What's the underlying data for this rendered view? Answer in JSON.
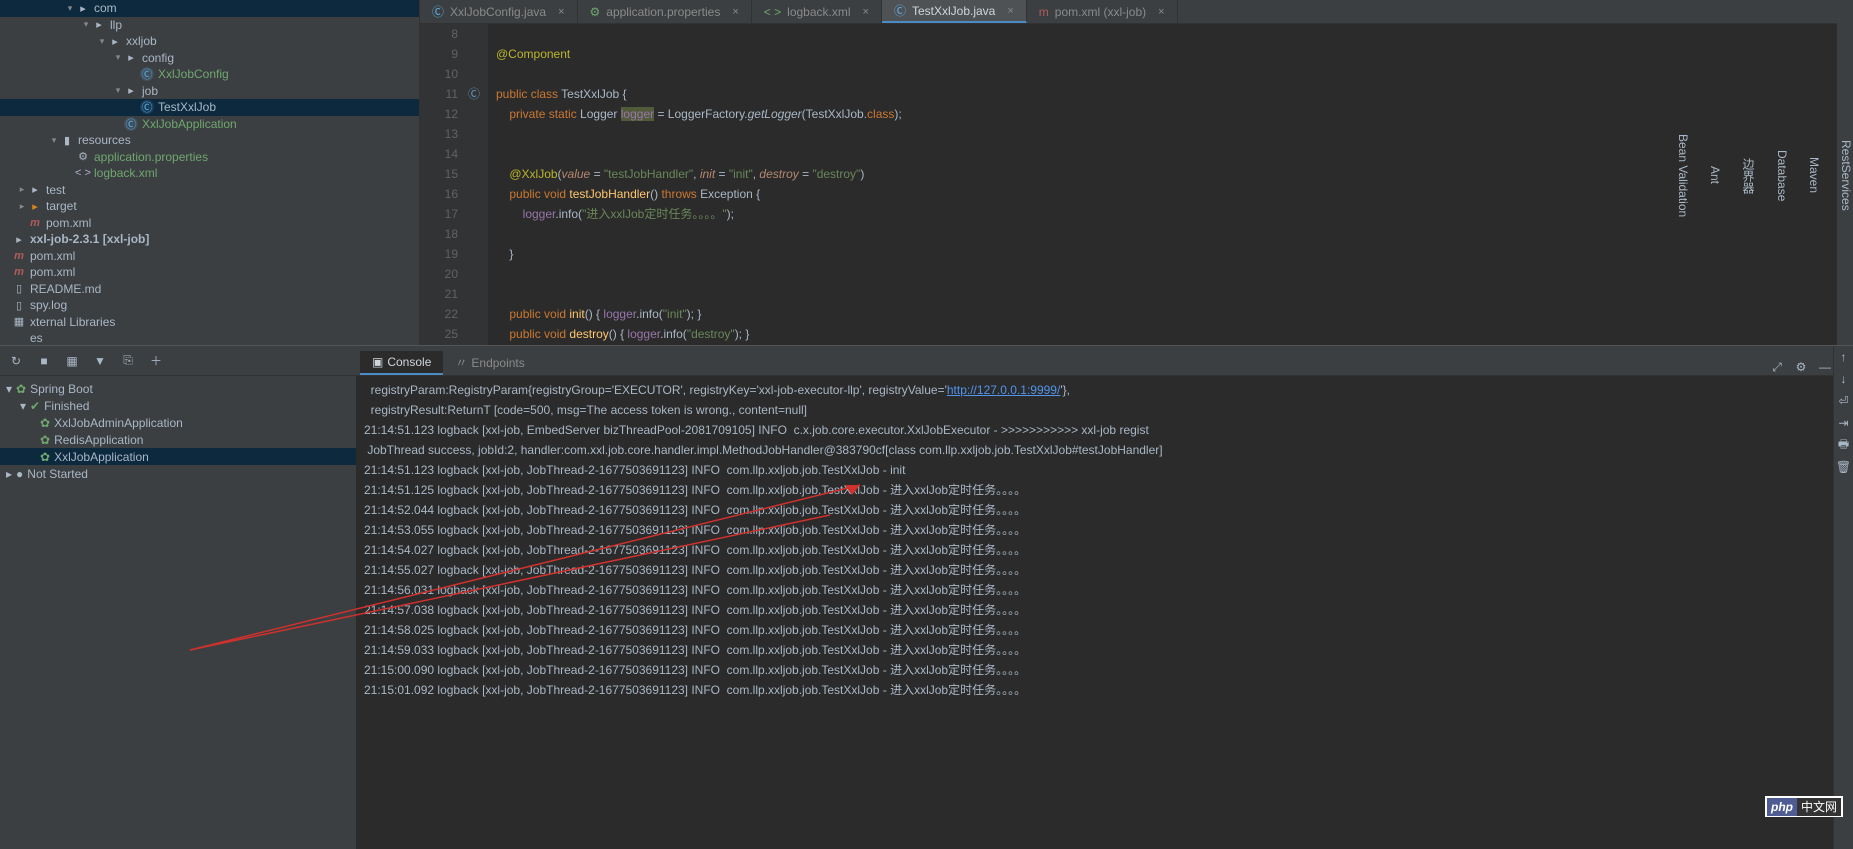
{
  "tree": [
    {
      "indent": 64,
      "arrow": "▾",
      "icon": "pkg",
      "label": "com"
    },
    {
      "indent": 80,
      "arrow": "▾",
      "icon": "pkg",
      "label": "llp"
    },
    {
      "indent": 96,
      "arrow": "▾",
      "icon": "pkg",
      "label": "xxljob"
    },
    {
      "indent": 112,
      "arrow": "▾",
      "icon": "pkg",
      "label": "config"
    },
    {
      "indent": 128,
      "arrow": "",
      "icon": "class",
      "label": "XxlJobConfig",
      "green": true
    },
    {
      "indent": 112,
      "arrow": "▾",
      "icon": "pkg",
      "label": "job"
    },
    {
      "indent": 128,
      "arrow": "",
      "icon": "class",
      "label": "TestXxlJob",
      "selected": true
    },
    {
      "indent": 112,
      "arrow": "",
      "icon": "class",
      "label": "XxlJobApplication",
      "green": true
    },
    {
      "indent": 48,
      "arrow": "▾",
      "icon": "res",
      "label": "resources"
    },
    {
      "indent": 64,
      "arrow": "",
      "icon": "prop",
      "label": "application.properties",
      "green": true
    },
    {
      "indent": 64,
      "arrow": "",
      "icon": "xml",
      "label": "logback.xml",
      "green": true
    },
    {
      "indent": 16,
      "arrow": "▸",
      "icon": "folder",
      "label": "test"
    },
    {
      "indent": 16,
      "arrow": "▸",
      "icon": "target",
      "label": "target"
    },
    {
      "indent": 16,
      "arrow": "",
      "icon": "maven",
      "label": "pom.xml"
    },
    {
      "indent": 0,
      "arrow": "",
      "icon": "folder",
      "label": "xxl-job-2.3.1 [xxl-job]",
      "bold": true
    },
    {
      "indent": 0,
      "arrow": "",
      "icon": "maven",
      "label": "pom.xml"
    },
    {
      "indent": 0,
      "arrow": "",
      "icon": "maven",
      "label": "pom.xml"
    },
    {
      "indent": 0,
      "arrow": "",
      "icon": "file",
      "label": "README.md"
    },
    {
      "indent": 0,
      "arrow": "",
      "icon": "file",
      "label": "spy.log"
    },
    {
      "indent": 0,
      "arrow": "",
      "icon": "lib",
      "label": "xternal Libraries"
    },
    {
      "indent": 0,
      "arrow": "",
      "icon": "",
      "label": "es"
    }
  ],
  "editorTabs": [
    {
      "icon": "class",
      "label": "XxlJobConfig.java",
      "active": false
    },
    {
      "icon": "prop",
      "label": "application.properties",
      "active": false
    },
    {
      "icon": "xml",
      "label": "logback.xml",
      "active": false
    },
    {
      "icon": "class",
      "label": "TestXxlJob.java",
      "active": true
    },
    {
      "icon": "maven",
      "label": "pom.xml (xxl-job)",
      "active": false
    }
  ],
  "code": {
    "startLine": 8,
    "lines": [
      {
        "n": 8,
        "html": ""
      },
      {
        "n": 9,
        "html": "<span class='ann'>@Component</span>"
      },
      {
        "n": 10,
        "html": ""
      },
      {
        "n": 11,
        "html": "<span class='kw'>public class </span><span class='cls'>TestXxlJob </span>{",
        "icon": "cls-gutter"
      },
      {
        "n": 12,
        "html": "    <span class='kw'>private static </span><span class='cls'>Logger </span><span class='def ident-bg'>logger</span> = <span class='cls'>LoggerFactory</span>.<span class='static-call'>getLogger</span>(<span class='cls'>TestXxlJob</span>.<span class='kw'>class</span>);"
      },
      {
        "n": 13,
        "html": ""
      },
      {
        "n": 14,
        "html": ""
      },
      {
        "n": 15,
        "html": "    <span class='ann'>@XxlJob</span>(<span class='param'>value</span> = <span class='str'>\"testJobHandler\"</span>, <span class='param'>init</span> = <span class='str'>\"init\"</span>, <span class='param'>destroy</span> = <span class='str'>\"destroy\"</span>)"
      },
      {
        "n": 16,
        "html": "    <span class='kw'>public void </span><span class='fn'>testJobHandler</span>() <span class='kw'>throws </span><span class='cls'>Exception </span>{"
      },
      {
        "n": 17,
        "html": "        <span class='def'>logger</span>.info(<span class='str'>\"进入xxlJob定时任务。。。。\"</span>);"
      },
      {
        "n": 18,
        "html": ""
      },
      {
        "n": 19,
        "html": "    }"
      },
      {
        "n": 20,
        "html": ""
      },
      {
        "n": 21,
        "html": ""
      },
      {
        "n": 22,
        "html": "    <span class='kw'>public void </span><span class='fn'>init</span>() { <span class='def'>logger</span>.info(<span class='str'>\"init\"</span>); }"
      },
      {
        "n": 25,
        "html": "    <span class='kw'>public void </span><span class='fn'>destroy</span>() { <span class='def'>logger</span>.info(<span class='str'>\"destroy\"</span>); }"
      }
    ]
  },
  "services": {
    "header": "Spring Boot",
    "finished": "Finished",
    "apps": [
      "XxlJobAdminApplication",
      "RedisApplication",
      "XxlJobApplication"
    ],
    "notstarted": "Not Started"
  },
  "runTabs": [
    {
      "label": "Console",
      "active": true
    },
    {
      "label": "Endpoints",
      "active": false
    }
  ],
  "console": [
    "  registryParam:RegistryParam{registryGroup='EXECUTOR', registryKey='xxl-job-executor-llp', registryValue='<a class='link'>http://127.0.0.1:9999/</a>'},",
    "  registryResult:ReturnT [code=500, msg=The access token is wrong., content=null]",
    "21:14:51.123 logback [xxl-job, EmbedServer bizThreadPool-2081709105] INFO  c.x.job.core.executor.XxlJobExecutor - >>>>>>>>>>> xxl-job regist",
    " JobThread success, jobId:2, handler:com.xxl.job.core.handler.impl.MethodJobHandler@383790cf[class com.llp.xxljob.job.TestXxlJob#testJobHandler]",
    "21:14:51.123 logback [xxl-job, JobThread-2-1677503691123] INFO  com.llp.xxljob.job.TestXxlJob - init",
    "21:14:51.125 logback [xxl-job, JobThread-2-1677503691123] INFO  com.llp.xxljob.job.TestXxlJob - 进入xxlJob定时任务。。。。",
    "21:14:52.044 logback [xxl-job, JobThread-2-1677503691123] INFO  com.llp.xxljob.job.TestXxlJob - 进入xxlJob定时任务。。。。",
    "21:14:53.055 logback [xxl-job, JobThread-2-1677503691123] INFO  com.llp.xxljob.job.TestXxlJob - 进入xxlJob定时任务。。。。",
    "21:14:54.027 logback [xxl-job, JobThread-2-1677503691123] INFO  com.llp.xxljob.job.TestXxlJob - 进入xxlJob定时任务。。。。",
    "21:14:55.027 logback [xxl-job, JobThread-2-1677503691123] INFO  com.llp.xxljob.job.TestXxlJob - 进入xxlJob定时任务。。。。",
    "21:14:56.031 logback [xxl-job, JobThread-2-1677503691123] INFO  com.llp.xxljob.job.TestXxlJob - 进入xxlJob定时任务。。。。",
    "21:14:57.038 logback [xxl-job, JobThread-2-1677503691123] INFO  com.llp.xxljob.job.TestXxlJob - 进入xxlJob定时任务。。。。",
    "21:14:58.025 logback [xxl-job, JobThread-2-1677503691123] INFO  com.llp.xxljob.job.TestXxlJob - 进入xxlJob定时任务。。。。",
    "21:14:59.033 logback [xxl-job, JobThread-2-1677503691123] INFO  com.llp.xxljob.job.TestXxlJob - 进入xxlJob定时任务。。。。",
    "21:15:00.090 logback [xxl-job, JobThread-2-1677503691123] INFO  com.llp.xxljob.job.TestXxlJob - 进入xxlJob定时任务。。。。",
    "21:15:01.092 logback [xxl-job, JobThread-2-1677503691123] INFO  com.llp.xxljob.job.TestXxlJob - 进入xxlJob定时任务。。。。"
  ],
  "rightBar": [
    "RestServices",
    "Maven",
    "Database",
    "边界器",
    "Ant",
    "Bean Validation"
  ],
  "watermark": {
    "a": "php",
    "b": "中文网"
  },
  "colors": {
    "accent": "#4a8bc4"
  }
}
